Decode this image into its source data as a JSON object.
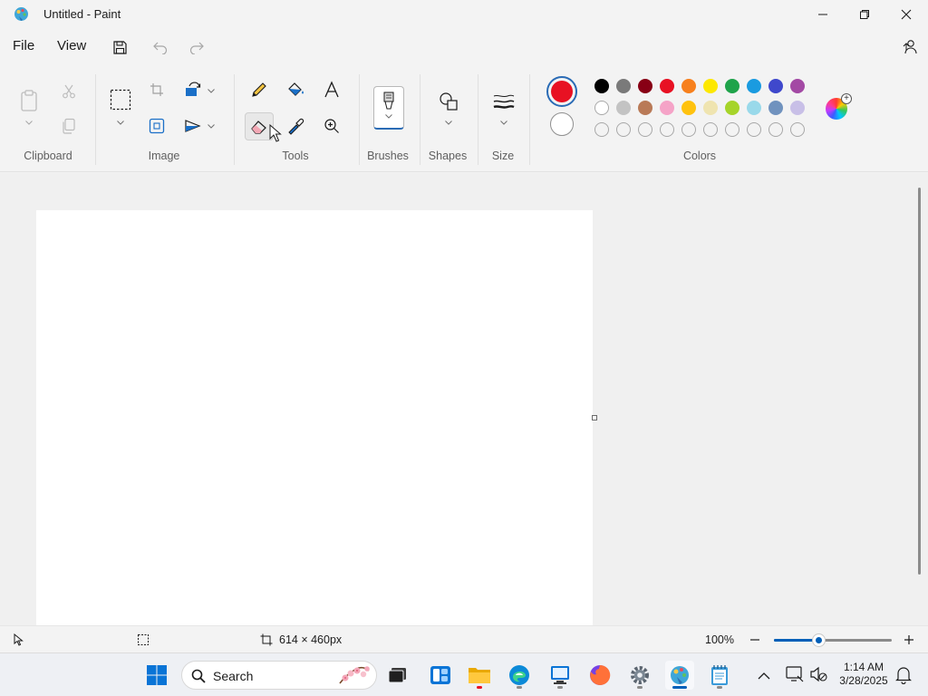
{
  "window": {
    "title": "Untitled - Paint"
  },
  "menu": {
    "file": "File",
    "view": "View"
  },
  "ribbon": {
    "groups": {
      "clipboard": "Clipboard",
      "image": "Image",
      "tools": "Tools",
      "brushes": "Brushes",
      "shapes": "Shapes",
      "size": "Size",
      "colors": "Colors"
    },
    "selected_tool": "eraser",
    "primary_color": "#e81123",
    "secondary_color": "#ffffff",
    "palette_row1": [
      "#000000",
      "#7a7a7a",
      "#880015",
      "#e81123",
      "#f7801d",
      "#fde800",
      "#1fa34a",
      "#1a9be0",
      "#3f48cc",
      "#a349a4"
    ],
    "palette_row2": [
      "#ffffff",
      "#c3c3c3",
      "#b97a57",
      "#f5a3c7",
      "#ffc20e",
      "#efe4b0",
      "#a6d42a",
      "#99d9ea",
      "#7092be",
      "#c8bfe7"
    ]
  },
  "status": {
    "canvas_size": "614 × 460px",
    "zoom": "100%",
    "zoom_fraction": 0.38
  },
  "taskbar": {
    "search_placeholder": "Search",
    "time": "1:14 AM",
    "date": "3/28/2025"
  }
}
